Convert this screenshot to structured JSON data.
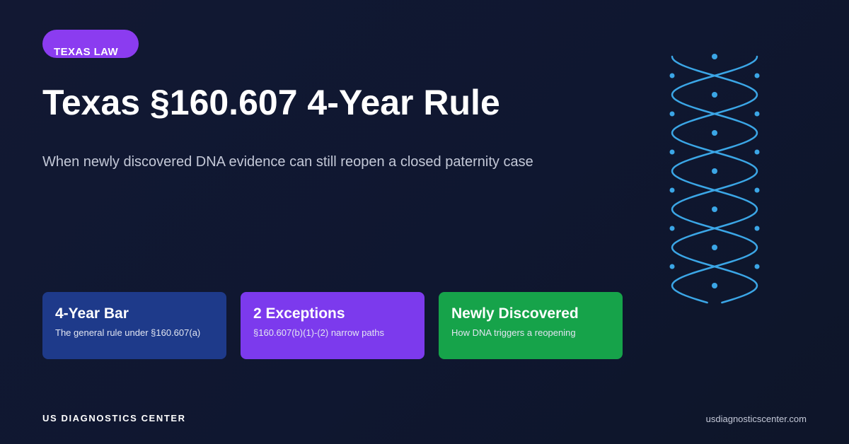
{
  "badge": {
    "label": "TEXAS LAW"
  },
  "hero": {
    "title": "Texas §160.607 4-Year Rule",
    "subtitle": "When newly discovered DNA evidence can still reopen a closed paternity case"
  },
  "cards": [
    {
      "title": "4-Year Bar",
      "description": "The general rule under §160.607(a)",
      "color": "#1e3a8a"
    },
    {
      "title": "2 Exceptions",
      "description": "§160.607(b)(1)-(2) narrow paths",
      "color": "#7c3aed"
    },
    {
      "title": "Newly Discovered",
      "description": "How DNA triggers a reopening",
      "color": "#16a34a"
    }
  ],
  "footer": {
    "brand": "US DIAGNOSTICS CENTER",
    "url": "usdiagnosticscenter.com"
  },
  "decoration": {
    "icon": "dna-helix-icon",
    "color": "#3ba6e6"
  },
  "colors": {
    "background": "#111831",
    "badge": "#8b3cf0",
    "subtitle": "#c4c9d8"
  }
}
